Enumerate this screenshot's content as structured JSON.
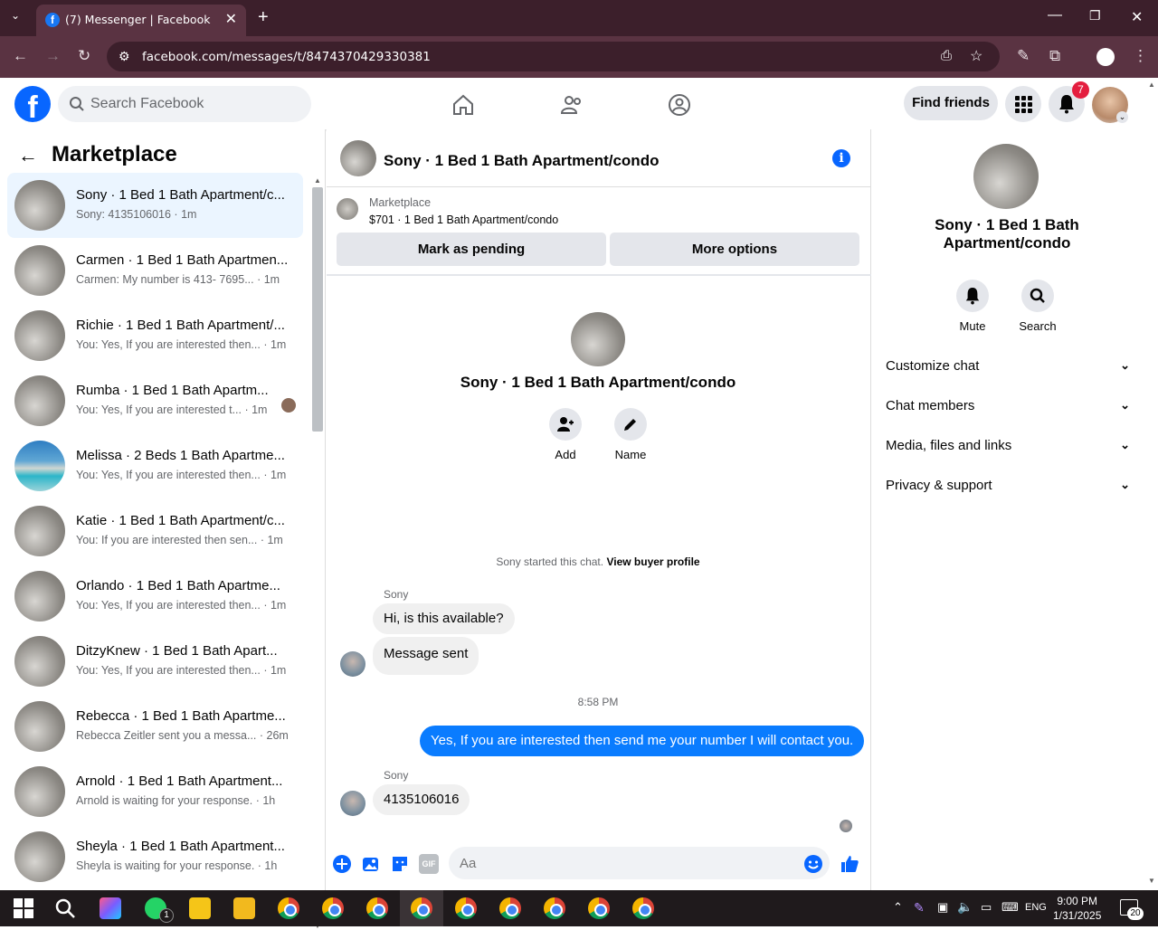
{
  "browser": {
    "tab_title": "(7) Messenger | Facebook",
    "url": "facebook.com/messages/t/8474370429330381"
  },
  "header": {
    "search_placeholder": "Search Facebook",
    "find_friends": "Find friends",
    "notif_count": "7"
  },
  "sidebar": {
    "title": "Marketplace",
    "conversations": [
      {
        "name": "Sony · 1 Bed 1 Bath Apartment/c...",
        "preview": "Sony: 4135106016 · 1m",
        "active": true
      },
      {
        "name": "Carmen · 1 Bed 1 Bath Apartmen...",
        "preview": "Carmen: My number is 413- 7695... · 1m"
      },
      {
        "name": "Richie · 1 Bed 1 Bath Apartment/...",
        "preview": "You: Yes, If you are interested then... · 1m"
      },
      {
        "name": "Rumba · 1 Bed 1 Bath Apartm...",
        "preview": "You: Yes, If you are interested t...  · 1m"
      },
      {
        "name": "Melissa · 2 Beds 1 Bath Apartme...",
        "preview": "You: Yes, If you are interested then... · 1m"
      },
      {
        "name": "Katie · 1 Bed 1 Bath Apartment/c...",
        "preview": "You: If you are interested then sen... · 1m"
      },
      {
        "name": "Orlando · 1 Bed 1 Bath Apartme...",
        "preview": "You: Yes, If you are interested then... · 1m"
      },
      {
        "name": "DitzyKnew · 1 Bed 1 Bath Apart...",
        "preview": "You: Yes, If you are interested then... · 1m"
      },
      {
        "name": "Rebecca · 1 Bed 1 Bath Apartme...",
        "preview": "Rebecca Zeitler sent you a messa... · 26m"
      },
      {
        "name": "Arnold · 1 Bed 1 Bath Apartment...",
        "preview": "Arnold is waiting for your response. · 1h"
      },
      {
        "name": "Sheyla · 1 Bed 1 Bath Apartment...",
        "preview": "Sheyla is waiting for your response. · 1h"
      }
    ]
  },
  "chat": {
    "title": "Sony · 1 Bed 1 Bath Apartment/condo",
    "marketplace_label": "Marketplace",
    "listing": "$701 · 1 Bed 1 Bath Apartment/condo",
    "mark_pending": "Mark as pending",
    "more_options": "More options",
    "intro_name": "Sony · 1 Bed 1 Bath Apartment/condo",
    "add_label": "Add",
    "name_label": "Name",
    "started_text": "Sony started this chat.",
    "view_buyer": "View buyer profile",
    "sender1": "Sony",
    "msg1": "Hi, is this available?",
    "msg2": "Message sent",
    "time": "8:58 PM",
    "my_msg": "Yes, If you are interested then send me your number I will contact you.",
    "sender2": "Sony",
    "msg3": "4135106016",
    "input_placeholder": "Aa"
  },
  "right_panel": {
    "name": "Sony · 1 Bed 1 Bath Apartment/condo",
    "mute": "Mute",
    "search": "Search",
    "sections": [
      "Customize chat",
      "Chat members",
      "Media, files and links",
      "Privacy & support"
    ]
  },
  "taskbar": {
    "lang": "ENG",
    "time": "9:00 PM",
    "date": "1/31/2025",
    "notif": "20",
    "whatsapp_badge": "1"
  },
  "colors": {
    "fb_blue": "#0866ff",
    "msg_blue": "#0a7cff",
    "chrome_frame": "#3c1f2b"
  }
}
